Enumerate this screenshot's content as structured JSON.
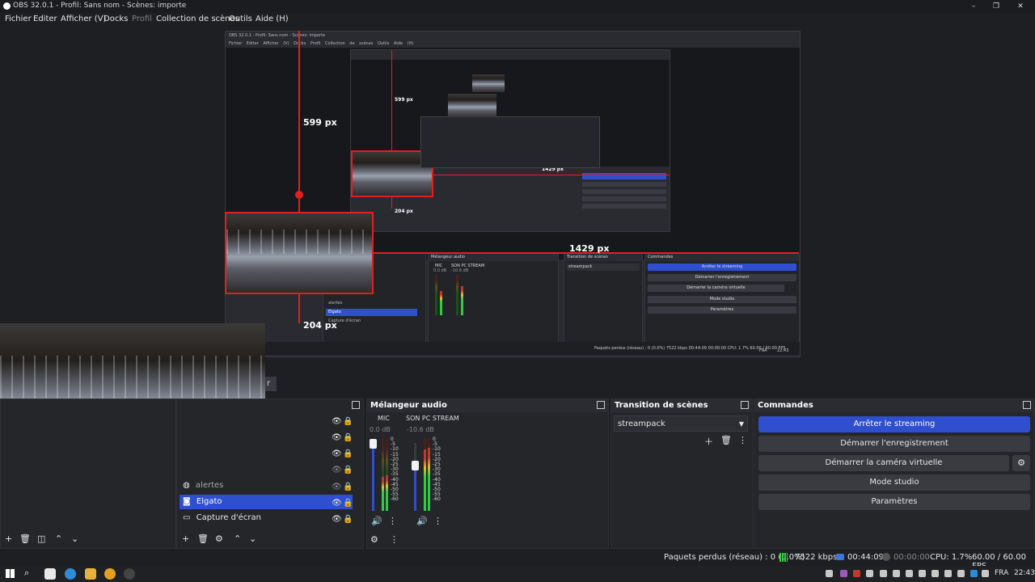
{
  "window": {
    "title": "OBS 32.0.1 - Profil: Sans nom - Scènes: importe",
    "controls": [
      "–",
      "❐",
      "✕"
    ]
  },
  "menu": [
    "Fichier",
    "Editer",
    "Afficher (V)",
    "Docks",
    "Profil",
    "Collection de scènes",
    "Outils",
    "Aide (H)"
  ],
  "preview": {
    "measurements": {
      "height_label": "599 px",
      "width_label": "1429 px",
      "offset_label": "204 px"
    },
    "nested": {
      "title": "OBS 32.0.1 - Profil: Sans nom - Scènes: importe",
      "menu": "Fichier Editer Afficher (V) Docks Profil Collection de scènes Outils Aide (H)",
      "mixer_title": "Mélangeur audio",
      "transition_title": "Transition de scènes",
      "commands_title": "Commandes",
      "transition_value": "streampack",
      "channels": [
        "MIC",
        "SON PC STREAM"
      ],
      "channel_db": [
        "0.0 dB",
        "-10.6 dB"
      ],
      "sources": [
        "alertes",
        "Elgato",
        "Capture d'écran"
      ],
      "buttons": [
        "Arrêter le streaming",
        "Démarrer l'enregistrement",
        "Démarrer la caméra virtuelle",
        "Mode studio",
        "Paramètres"
      ],
      "status": "Paquets perdus (réseau) : 0 (0.0%)   7522 kbps   00:44:09   00:00:00   CPU: 1.7%   60.00 / 60.00 FPS",
      "tray_time": "22:43",
      "tray_lang": "FRA",
      "nested_labels": {
        "height": "599 px",
        "width": "1429 px",
        "offset": "204 px"
      }
    }
  },
  "sources_panel": {
    "items": [
      {
        "label": "alertes",
        "icon": "globe-icon",
        "visible": false,
        "selected": false
      },
      {
        "label": "Elgato",
        "icon": "camera-icon",
        "visible": true,
        "selected": true
      },
      {
        "label": "Capture d'écran",
        "icon": "monitor-icon",
        "visible": true,
        "selected": false
      }
    ],
    "partial_label": "r"
  },
  "mixer": {
    "title": "Mélangeur audio",
    "channels": [
      {
        "name": "MIC",
        "db": "0.0 dB",
        "level": 0.0
      },
      {
        "name": "SON PC STREAM",
        "db": "-10.6 dB",
        "level": 0.8
      }
    ],
    "scale": [
      "0",
      "-5",
      "-10",
      "-15",
      "-20",
      "-25",
      "-30",
      "-35",
      "-40",
      "-45",
      "-50",
      "-55",
      "-60"
    ]
  },
  "transitions": {
    "title": "Transition de scènes",
    "selected": "streampack"
  },
  "commands": {
    "title": "Commandes",
    "stop_stream": "Arrêter le streaming",
    "start_recording": "Démarrer l'enregistrement",
    "start_virtualcam": "Démarrer la caméra virtuelle",
    "studio_mode": "Mode studio",
    "settings": "Paramètres"
  },
  "status": {
    "dropped": "Paquets perdus (réseau) : 0 (0.0%)",
    "bitrate": "7522 kbps",
    "stream_time": "00:44:09",
    "rec_time": "00:00:00",
    "cpu": "CPU: 1.7%",
    "fps": "60.00 / 60.00 FPS"
  },
  "taskbar": {
    "lang": "FRA",
    "time": "22:43"
  },
  "colors": {
    "accent": "#2f4fcf",
    "measure_red": "#e02020",
    "background": "#1e1f22"
  }
}
